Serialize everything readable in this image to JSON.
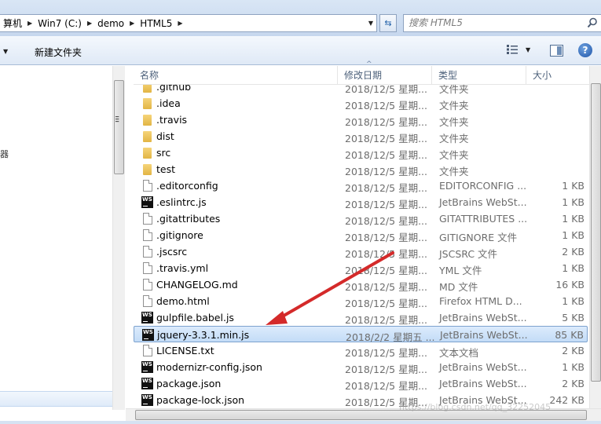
{
  "address": {
    "crumbs": [
      "算机",
      "Win7 (C:)",
      "demo",
      "HTML5"
    ]
  },
  "search": {
    "placeholder": "搜索 HTML5"
  },
  "toolbar": {
    "new_folder": "新建文件夹"
  },
  "columns": {
    "name": "名称",
    "date": "修改日期",
    "type": "类型",
    "size": "大小"
  },
  "files": [
    {
      "icon": "folder-icon",
      "name": ".github",
      "date": "2018/12/5 星期...",
      "type": "文件夹",
      "size": ""
    },
    {
      "icon": "folder-icon",
      "name": ".idea",
      "date": "2018/12/5 星期...",
      "type": "文件夹",
      "size": ""
    },
    {
      "icon": "folder-icon",
      "name": ".travis",
      "date": "2018/12/5 星期...",
      "type": "文件夹",
      "size": ""
    },
    {
      "icon": "folder-icon",
      "name": "dist",
      "date": "2018/12/5 星期...",
      "type": "文件夹",
      "size": ""
    },
    {
      "icon": "folder-icon",
      "name": "src",
      "date": "2018/12/5 星期...",
      "type": "文件夹",
      "size": ""
    },
    {
      "icon": "folder-icon",
      "name": "test",
      "date": "2018/12/5 星期...",
      "type": "文件夹",
      "size": ""
    },
    {
      "icon": "file-icon",
      "name": ".editorconfig",
      "date": "2018/12/5 星期...",
      "type": "EDITORCONFIG ...",
      "size": "1 KB"
    },
    {
      "icon": "webstorm-icon",
      "name": ".eslintrc.js",
      "date": "2018/12/5 星期...",
      "type": "JetBrains WebSt...",
      "size": "1 KB"
    },
    {
      "icon": "file-icon",
      "name": ".gitattributes",
      "date": "2018/12/5 星期...",
      "type": "GITATTRIBUTES ...",
      "size": "1 KB"
    },
    {
      "icon": "file-icon",
      "name": ".gitignore",
      "date": "2018/12/5 星期...",
      "type": "GITIGNORE 文件",
      "size": "1 KB"
    },
    {
      "icon": "file-icon",
      "name": ".jscsrc",
      "date": "2018/12/5 星期...",
      "type": "JSCSRC 文件",
      "size": "2 KB"
    },
    {
      "icon": "file-icon",
      "name": ".travis.yml",
      "date": "2018/12/5 星期...",
      "type": "YML 文件",
      "size": "1 KB"
    },
    {
      "icon": "file-icon",
      "name": "CHANGELOG.md",
      "date": "2018/12/5 星期...",
      "type": "MD 文件",
      "size": "16 KB"
    },
    {
      "icon": "file-icon",
      "name": "demo.html",
      "date": "2018/12/5 星期...",
      "type": "Firefox HTML D...",
      "size": "1 KB"
    },
    {
      "icon": "webstorm-icon",
      "name": "gulpfile.babel.js",
      "date": "2018/12/5 星期...",
      "type": "JetBrains WebSt...",
      "size": "5 KB"
    },
    {
      "icon": "webstorm-icon",
      "name": "jquery-3.3.1.min.js",
      "date": "2018/2/2 星期五 ...",
      "type": "JetBrains WebSt...",
      "size": "85 KB",
      "selected": true
    },
    {
      "icon": "file-icon",
      "name": "LICENSE.txt",
      "date": "2018/12/5 星期...",
      "type": "文本文档",
      "size": "2 KB"
    },
    {
      "icon": "webstorm-icon",
      "name": "modernizr-config.json",
      "date": "2018/12/5 星期...",
      "type": "JetBrains WebSt...",
      "size": "1 KB"
    },
    {
      "icon": "webstorm-icon",
      "name": "package.json",
      "date": "2018/12/5 星期...",
      "type": "JetBrains WebSt...",
      "size": "2 KB"
    },
    {
      "icon": "webstorm-icon",
      "name": "package-lock.json",
      "date": "2018/12/5 星期...",
      "type": "JetBrains WebSt...",
      "size": "242 KB"
    }
  ],
  "icon_labels": {
    "ws": "WS"
  },
  "nav": {
    "glyph": "器"
  },
  "watermark": "https://blog.csdn.net/qq_32252045",
  "colors": {
    "annotation_arrow": "#d42a2a",
    "selection": "#c3dcf7"
  }
}
